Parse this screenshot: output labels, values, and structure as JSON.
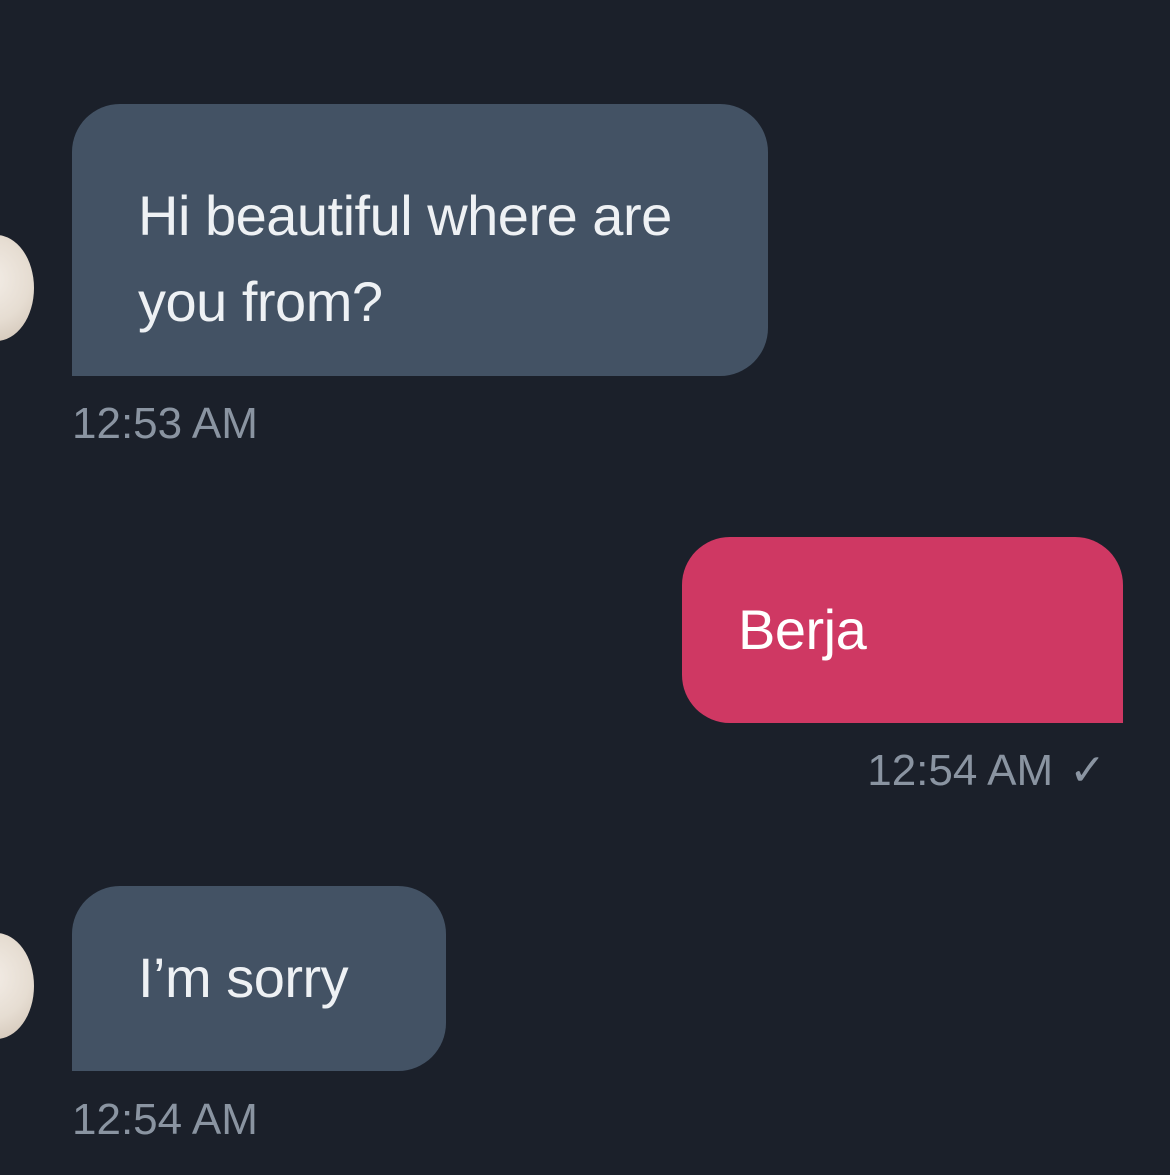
{
  "messages": [
    {
      "direction": "incoming",
      "text": "Hi beautiful where are you from?",
      "time": "12:53 AM"
    },
    {
      "direction": "outgoing",
      "text": "Berja",
      "time": "12:54 AM",
      "status_icon": "checkmark-icon",
      "status_glyph": "✓"
    },
    {
      "direction": "incoming",
      "text": "I’m sorry",
      "time": "12:54 AM"
    }
  ],
  "colors": {
    "background": "#1b202a",
    "incoming_bubble": "#435264",
    "outgoing_bubble": "#cf3863",
    "timestamp": "#8a94a1"
  }
}
